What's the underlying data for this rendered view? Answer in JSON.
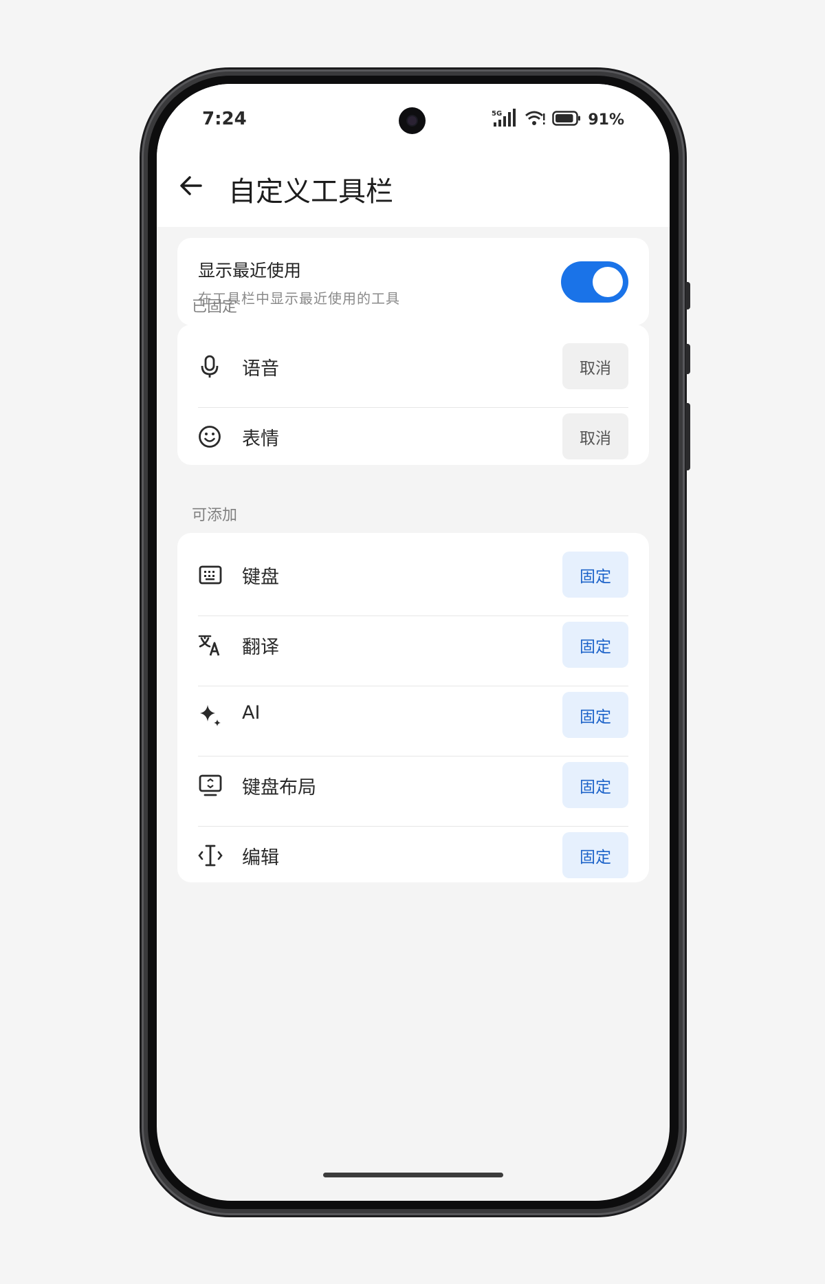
{
  "status_bar": {
    "time": "7:24",
    "network": "5G",
    "battery_percent": "91%",
    "battery_level": 0.91
  },
  "header": {
    "title": "自定义工具栏",
    "back_icon": "arrow-left-icon"
  },
  "recent": {
    "title": "显示最近使用",
    "subtitle": "在工具栏中显示最近使用的工具",
    "toggle_on": true,
    "toggle_color": "#1a73e8"
  },
  "pinned": {
    "label": "已固定",
    "items": [
      {
        "label": "语音",
        "icon": "microphone-icon",
        "action": "取消"
      },
      {
        "label": "表情",
        "icon": "smiley-icon",
        "action": "取消"
      }
    ]
  },
  "available": {
    "label": "可添加",
    "items": [
      {
        "label": "键盘",
        "icon": "keyboard-icon",
        "action": "固定"
      },
      {
        "label": "翻译",
        "icon": "translate-icon",
        "action": "固定"
      },
      {
        "label": "AI",
        "icon": "sparkle-icon",
        "action": "固定"
      },
      {
        "label": "键盘布局",
        "icon": "keyboard-layout-icon",
        "action": "固定"
      },
      {
        "label": "编辑",
        "icon": "text-cursor-icon",
        "action": "固定"
      }
    ]
  },
  "colors": {
    "accent": "#1a73e8",
    "pin_button_bg": "#e6f0fd",
    "pin_button_text": "#1d63c9",
    "cancel_button_bg": "#f0f0f0"
  }
}
